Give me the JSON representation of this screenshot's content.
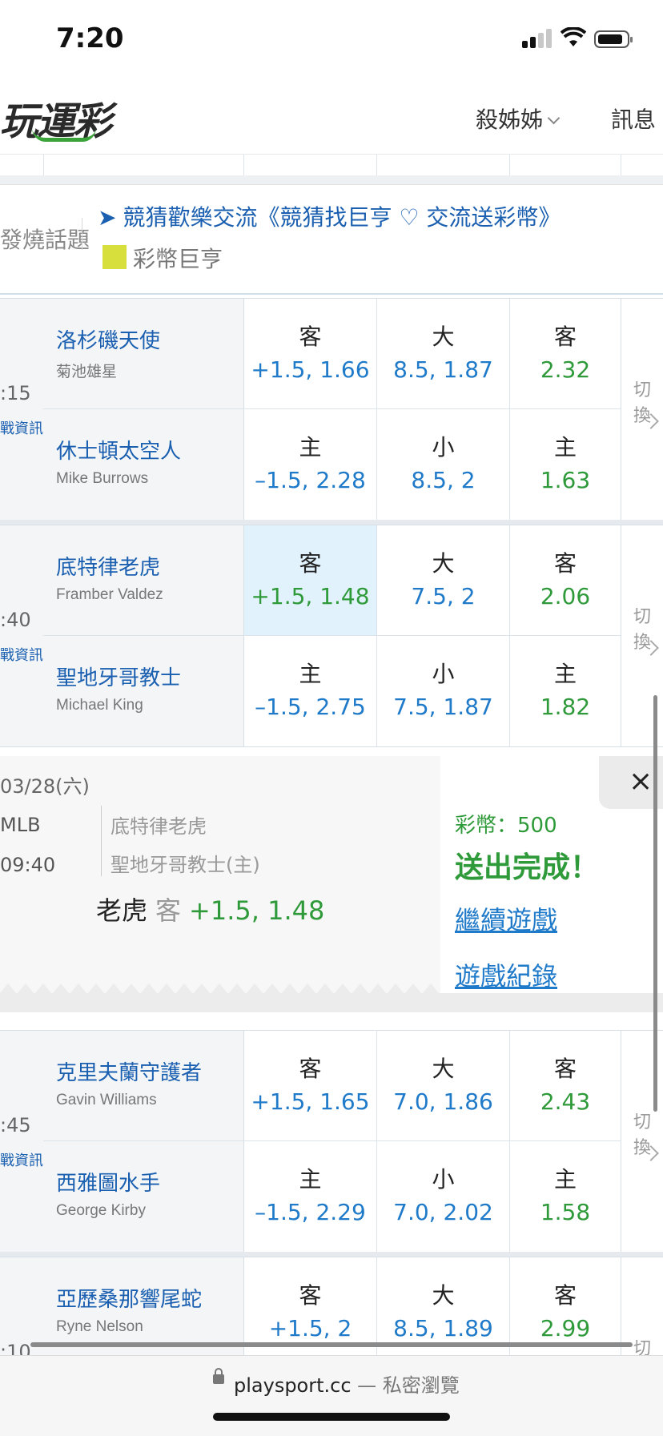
{
  "status_bar": {
    "time": "7:20"
  },
  "header": {
    "logo_text": "玩運彩",
    "user_label": "殺姊姊",
    "message_label": "訊息"
  },
  "topic": {
    "label": "發燒話題",
    "link_text": "競猜歡樂交流《競猜找巨亨 ♡ 交流送彩幣》",
    "badge_label": "彩幣巨亨"
  },
  "games": [
    {
      "time": ":15",
      "info": "戰資訊",
      "away": {
        "team": "洛杉磯天使",
        "pitcher": "菊池雄星",
        "spread_side": "客",
        "spread": "+1.5, 1.66",
        "total_side": "大",
        "total": "8.5, 1.87",
        "ml_side": "客",
        "ml": "2.32"
      },
      "home": {
        "team": "休士頓太空人",
        "pitcher": "Mike Burrows",
        "spread_side": "主",
        "spread": "–1.5, 2.28",
        "total_side": "小",
        "total": "8.5, 2",
        "ml_side": "主",
        "ml": "1.63"
      },
      "switch": "切換"
    },
    {
      "time": ":40",
      "info": "戰資訊",
      "away": {
        "team": "底特律老虎",
        "pitcher": "Framber Valdez",
        "spread_side": "客",
        "spread": "+1.5, 1.48",
        "total_side": "大",
        "total": "7.5, 2",
        "ml_side": "客",
        "ml": "2.06"
      },
      "home": {
        "team": "聖地牙哥教士",
        "pitcher": "Michael King",
        "spread_side": "主",
        "spread": "–1.5, 2.75",
        "total_side": "小",
        "total": "7.5, 1.87",
        "ml_side": "主",
        "ml": "1.82"
      },
      "switch": "切換"
    },
    {
      "time": ":45",
      "info": "戰資訊",
      "away": {
        "team": "克里夫蘭守護者",
        "pitcher": "Gavin Williams",
        "spread_side": "客",
        "spread": "+1.5, 1.65",
        "total_side": "大",
        "total": "7.0, 1.86",
        "ml_side": "客",
        "ml": "2.43"
      },
      "home": {
        "team": "西雅圖水手",
        "pitcher": "George Kirby",
        "spread_side": "主",
        "spread": "–1.5, 2.29",
        "total_side": "小",
        "total": "7.0, 2.02",
        "ml_side": "主",
        "ml": "1.58"
      },
      "switch": "切換"
    },
    {
      "time": ":10",
      "away": {
        "team": "亞歷桑那響尾蛇",
        "pitcher": "Ryne Nelson",
        "spread_side": "客",
        "spread": "+1.5, 2",
        "total_side": "大",
        "total": "8.5, 1.89",
        "ml_side": "客",
        "ml": "2.99"
      },
      "switch": "切換"
    }
  ],
  "confirmation": {
    "date": "03/28(六)",
    "league": "MLB",
    "game_time": "09:40",
    "away_team": "底特律老虎",
    "home_team": "聖地牙哥教士(主)",
    "pick_team": "老虎",
    "pick_side": "客",
    "pick_odds": "+1.5, 1.48",
    "coins_text": "彩幣：500",
    "done_text": "送出完成！",
    "continue_link": "繼續遊戲",
    "history_link": "遊戲紀錄",
    "close_symbol": "×"
  },
  "browser": {
    "url": "playsport.cc",
    "mode": " — 私密瀏覽"
  },
  "colors": {
    "accent_blue": "#1f7ac9",
    "odds_green": "#2f9a3a",
    "link_blue": "#1a5fb0",
    "selected_bg": "#e2f2fc",
    "badge": "#d6df3c"
  }
}
